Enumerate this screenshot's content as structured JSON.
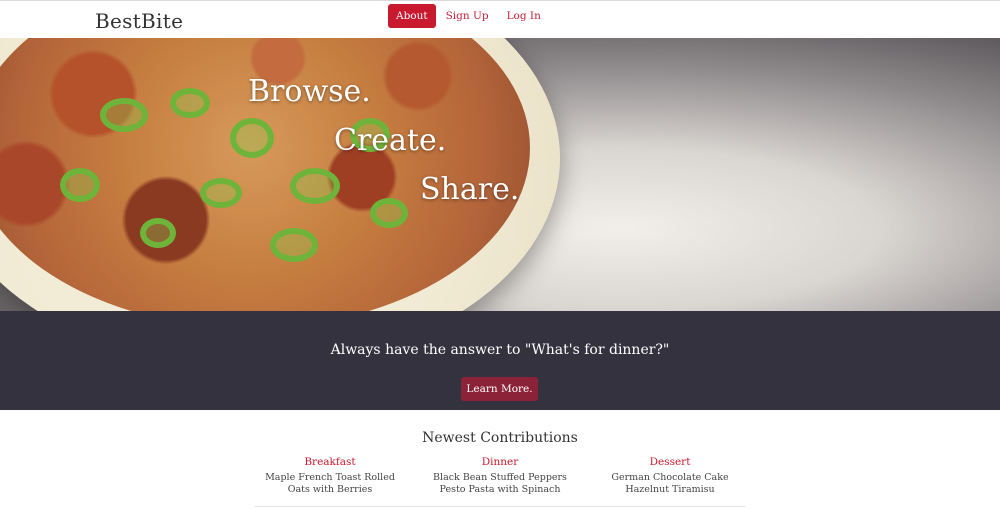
{
  "navbar": {
    "brand": "BestBite",
    "items": [
      {
        "label": "About",
        "active": true
      },
      {
        "label": "Sign Up",
        "active": false
      },
      {
        "label": "Log In",
        "active": false
      }
    ]
  },
  "hero": {
    "lines": [
      "Browse.",
      "Create.",
      "Share."
    ]
  },
  "band": {
    "text": "Always have the answer to \"What's for dinner?\"",
    "button_label": "Learn More."
  },
  "newest": {
    "title": "Newest Contributions",
    "items": [
      {
        "category": "Breakfast",
        "title": "Maple French Toast Rolled Oats with Berries"
      },
      {
        "category": "Dinner",
        "title": "Black Bean Stuffed Peppers Pesto Pasta with Spinach"
      },
      {
        "category": "Dessert",
        "title": "German Chocolate Cake Hazelnut Tiramisu"
      }
    ]
  },
  "colors": {
    "accent": "#c8192e",
    "band": "#34323f",
    "button": "#8c2238"
  }
}
